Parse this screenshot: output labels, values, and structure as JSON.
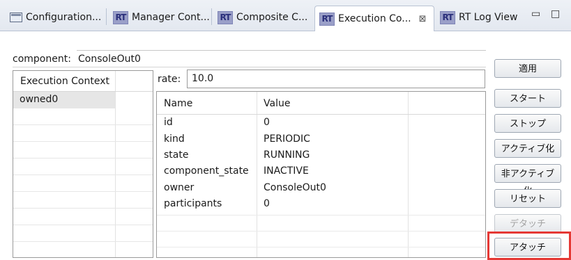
{
  "tabs": [
    {
      "label": "Configuration...",
      "icon": "configuration-view-icon"
    },
    {
      "label": "Manager Cont...",
      "icon": "rt-icon"
    },
    {
      "label": "Composite C...",
      "icon": "rt-icon"
    },
    {
      "label": "Execution Co...",
      "icon": "rt-icon",
      "active": true,
      "close": "⊠"
    },
    {
      "label": "RT Log View",
      "icon": "rt-icon"
    }
  ],
  "tab_icon_text": "RT",
  "window_controls": {
    "minimize": "▭",
    "maximize": "□"
  },
  "component": {
    "label": "component:",
    "value": "ConsoleOut0"
  },
  "execution_context": {
    "header": "Execution Context",
    "items": [
      "owned0"
    ]
  },
  "rate": {
    "label": "rate:",
    "value": "10.0"
  },
  "properties": {
    "columns": [
      "Name",
      "Value"
    ],
    "rows": [
      {
        "name": "id",
        "value": "0"
      },
      {
        "name": "kind",
        "value": "PERIODIC"
      },
      {
        "name": "state",
        "value": "RUNNING"
      },
      {
        "name": "component_state",
        "value": "INACTIVE"
      },
      {
        "name": "owner",
        "value": "ConsoleOut0"
      },
      {
        "name": "participants",
        "value": "0"
      }
    ]
  },
  "buttons": {
    "apply": "適用",
    "start": "スタート",
    "stop": "ストップ",
    "activate": "アクティブ化",
    "deactivate": "非アクティブ化",
    "reset": "リセット",
    "detach": "デタッチ",
    "attach": "アタッチ"
  },
  "colors": {
    "highlight": "#e53935",
    "rt_icon": "#9a9fc8"
  }
}
